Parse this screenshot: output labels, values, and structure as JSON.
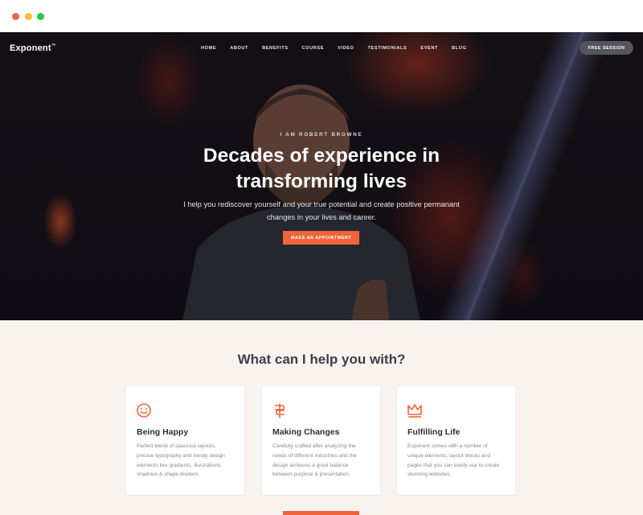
{
  "browser": {
    "controls": [
      "close",
      "minimize",
      "maximize"
    ]
  },
  "header": {
    "logo": "Exponent",
    "logo_mark": "™",
    "nav": [
      "HOME",
      "ABOUT",
      "BENEFITS",
      "COURSE",
      "VIDEO",
      "TESTIMONIALS",
      "EVENT",
      "BLOG"
    ],
    "cta": "FREE SESSION"
  },
  "hero": {
    "eyebrow": "I AM ROBERT BROWNE",
    "headline_line1": "Decades of experience in",
    "headline_line2": "transforming lives",
    "sub_line1": "I help you rediscover yourself and your true potential and create positive permanant",
    "sub_line2": "changes in your lives and career.",
    "button": "MAKE AN APPOINTMENT"
  },
  "services": {
    "title": "What can I help you with?",
    "cards": [
      {
        "icon": "smiley-icon",
        "title": "Being Happy",
        "lines": [
          "Perfect blend of spacious layouts,",
          "precise typography and trendy design",
          "elements like gradients, illustrations,",
          "shadows & shape dividers."
        ]
      },
      {
        "icon": "signpost-icon",
        "title": "Making Changes",
        "lines": [
          "Carefully crafted after analyzing the",
          "needs of different industries and the",
          "design achieves a great balance",
          "between purpose & presentation."
        ]
      },
      {
        "icon": "crown-icon",
        "title": "Fulfilling Life",
        "lines": [
          "Exponent comes with a number of",
          "unique elements, layout blocks and",
          "pages that you can easily use to create",
          "stunning websites."
        ]
      }
    ]
  },
  "colors": {
    "accent": "#f0643b",
    "section_bg": "#f8f3ef",
    "heading": "#3e3e46"
  }
}
